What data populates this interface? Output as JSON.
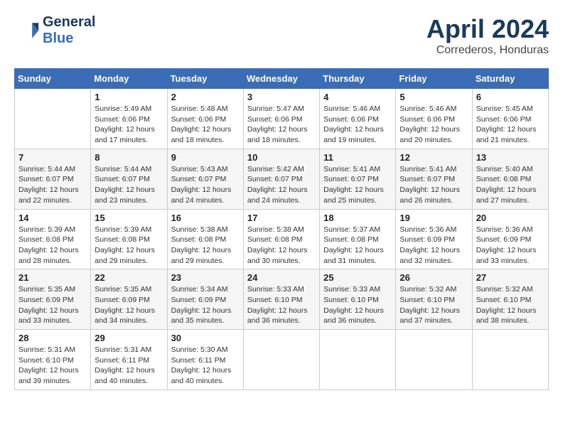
{
  "header": {
    "logo_general": "General",
    "logo_blue": "Blue",
    "month_title": "April 2024",
    "location": "Correderos, Honduras"
  },
  "days_of_week": [
    "Sunday",
    "Monday",
    "Tuesday",
    "Wednesday",
    "Thursday",
    "Friday",
    "Saturday"
  ],
  "weeks": [
    [
      {
        "day": "",
        "info": ""
      },
      {
        "day": "1",
        "info": "Sunrise: 5:49 AM\nSunset: 6:06 PM\nDaylight: 12 hours\nand 17 minutes."
      },
      {
        "day": "2",
        "info": "Sunrise: 5:48 AM\nSunset: 6:06 PM\nDaylight: 12 hours\nand 18 minutes."
      },
      {
        "day": "3",
        "info": "Sunrise: 5:47 AM\nSunset: 6:06 PM\nDaylight: 12 hours\nand 18 minutes."
      },
      {
        "day": "4",
        "info": "Sunrise: 5:46 AM\nSunset: 6:06 PM\nDaylight: 12 hours\nand 19 minutes."
      },
      {
        "day": "5",
        "info": "Sunrise: 5:46 AM\nSunset: 6:06 PM\nDaylight: 12 hours\nand 20 minutes."
      },
      {
        "day": "6",
        "info": "Sunrise: 5:45 AM\nSunset: 6:06 PM\nDaylight: 12 hours\nand 21 minutes."
      }
    ],
    [
      {
        "day": "7",
        "info": "Sunrise: 5:44 AM\nSunset: 6:07 PM\nDaylight: 12 hours\nand 22 minutes."
      },
      {
        "day": "8",
        "info": "Sunrise: 5:44 AM\nSunset: 6:07 PM\nDaylight: 12 hours\nand 23 minutes."
      },
      {
        "day": "9",
        "info": "Sunrise: 5:43 AM\nSunset: 6:07 PM\nDaylight: 12 hours\nand 24 minutes."
      },
      {
        "day": "10",
        "info": "Sunrise: 5:42 AM\nSunset: 6:07 PM\nDaylight: 12 hours\nand 24 minutes."
      },
      {
        "day": "11",
        "info": "Sunrise: 5:41 AM\nSunset: 6:07 PM\nDaylight: 12 hours\nand 25 minutes."
      },
      {
        "day": "12",
        "info": "Sunrise: 5:41 AM\nSunset: 6:07 PM\nDaylight: 12 hours\nand 26 minutes."
      },
      {
        "day": "13",
        "info": "Sunrise: 5:40 AM\nSunset: 6:08 PM\nDaylight: 12 hours\nand 27 minutes."
      }
    ],
    [
      {
        "day": "14",
        "info": "Sunrise: 5:39 AM\nSunset: 6:08 PM\nDaylight: 12 hours\nand 28 minutes."
      },
      {
        "day": "15",
        "info": "Sunrise: 5:39 AM\nSunset: 6:08 PM\nDaylight: 12 hours\nand 29 minutes."
      },
      {
        "day": "16",
        "info": "Sunrise: 5:38 AM\nSunset: 6:08 PM\nDaylight: 12 hours\nand 29 minutes."
      },
      {
        "day": "17",
        "info": "Sunrise: 5:38 AM\nSunset: 6:08 PM\nDaylight: 12 hours\nand 30 minutes."
      },
      {
        "day": "18",
        "info": "Sunrise: 5:37 AM\nSunset: 6:08 PM\nDaylight: 12 hours\nand 31 minutes."
      },
      {
        "day": "19",
        "info": "Sunrise: 5:36 AM\nSunset: 6:09 PM\nDaylight: 12 hours\nand 32 minutes."
      },
      {
        "day": "20",
        "info": "Sunrise: 5:36 AM\nSunset: 6:09 PM\nDaylight: 12 hours\nand 33 minutes."
      }
    ],
    [
      {
        "day": "21",
        "info": "Sunrise: 5:35 AM\nSunset: 6:09 PM\nDaylight: 12 hours\nand 33 minutes."
      },
      {
        "day": "22",
        "info": "Sunrise: 5:35 AM\nSunset: 6:09 PM\nDaylight: 12 hours\nand 34 minutes."
      },
      {
        "day": "23",
        "info": "Sunrise: 5:34 AM\nSunset: 6:09 PM\nDaylight: 12 hours\nand 35 minutes."
      },
      {
        "day": "24",
        "info": "Sunrise: 5:33 AM\nSunset: 6:10 PM\nDaylight: 12 hours\nand 36 minutes."
      },
      {
        "day": "25",
        "info": "Sunrise: 5:33 AM\nSunset: 6:10 PM\nDaylight: 12 hours\nand 36 minutes."
      },
      {
        "day": "26",
        "info": "Sunrise: 5:32 AM\nSunset: 6:10 PM\nDaylight: 12 hours\nand 37 minutes."
      },
      {
        "day": "27",
        "info": "Sunrise: 5:32 AM\nSunset: 6:10 PM\nDaylight: 12 hours\nand 38 minutes."
      }
    ],
    [
      {
        "day": "28",
        "info": "Sunrise: 5:31 AM\nSunset: 6:10 PM\nDaylight: 12 hours\nand 39 minutes."
      },
      {
        "day": "29",
        "info": "Sunrise: 5:31 AM\nSunset: 6:11 PM\nDaylight: 12 hours\nand 40 minutes."
      },
      {
        "day": "30",
        "info": "Sunrise: 5:30 AM\nSunset: 6:11 PM\nDaylight: 12 hours\nand 40 minutes."
      },
      {
        "day": "",
        "info": ""
      },
      {
        "day": "",
        "info": ""
      },
      {
        "day": "",
        "info": ""
      },
      {
        "day": "",
        "info": ""
      }
    ]
  ]
}
